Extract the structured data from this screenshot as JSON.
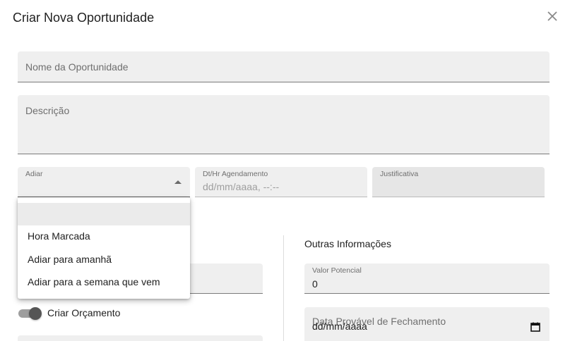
{
  "dialog": {
    "title": "Criar Nova Oportunidade",
    "close_icon": "close-icon"
  },
  "form": {
    "nome_label": "Nome da Oportunidade",
    "descricao_label": "Descrição",
    "adiar": {
      "label": "Adiar",
      "value": "",
      "options": [
        "",
        "Hora Marcada",
        "Adiar para amanhã",
        "Adiar para a semana que vem"
      ]
    },
    "agendamento": {
      "label": "Dt/Hr Agendamento",
      "placeholder": "dd/mm/aaaa, --:--"
    },
    "justificativa": {
      "label": "Justificativa"
    },
    "criar_orcamento": {
      "label": "Criar Orçamento",
      "checked": true
    },
    "outras_informacoes": {
      "title": "Outras Informações",
      "valor_potencial": {
        "label": "Valor Potencial",
        "value": "0"
      },
      "data_fechamento": {
        "label": "Data Provável de Fechamento",
        "placeholder": "dd/mm/aaaa"
      }
    }
  },
  "colors": {
    "field_bg": "#efefef",
    "disabled_field_bg": "#e6e6e6",
    "toggle_knob": "#555555",
    "toggle_track": "#9e9e9e"
  }
}
